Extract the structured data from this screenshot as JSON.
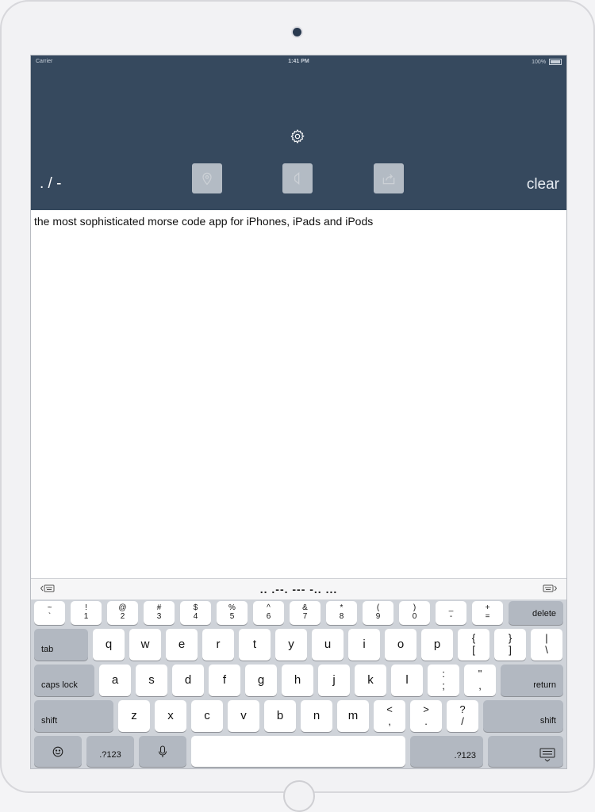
{
  "status": {
    "carrier": "Carrier",
    "time": "1:41 PM",
    "battery": "100%"
  },
  "header": {
    "morse_symbols": ". / -",
    "clear_label": "clear",
    "icons": [
      "gear-icon",
      "location-pin-icon",
      "speaker-icon",
      "share-icon"
    ]
  },
  "content": {
    "text": "the most sophisticated morse code app for iPhones, iPads and iPods"
  },
  "keyboard": {
    "morse_preview": ".. .--. --- -.. ...",
    "number_row": [
      {
        "top": "~",
        "bottom": "`"
      },
      {
        "top": "!",
        "bottom": "1"
      },
      {
        "top": "@",
        "bottom": "2"
      },
      {
        "top": "#",
        "bottom": "3"
      },
      {
        "top": "$",
        "bottom": "4"
      },
      {
        "top": "%",
        "bottom": "5"
      },
      {
        "top": "^",
        "bottom": "6"
      },
      {
        "top": "&",
        "bottom": "7"
      },
      {
        "top": "*",
        "bottom": "8"
      },
      {
        "top": "(",
        "bottom": "9"
      },
      {
        "top": ")",
        "bottom": "0"
      },
      {
        "top": "_",
        "bottom": "-"
      },
      {
        "top": "+",
        "bottom": "="
      }
    ],
    "delete_label": "delete",
    "tab_label": "tab",
    "row_q": [
      "q",
      "w",
      "e",
      "r",
      "t",
      "y",
      "u",
      "i",
      "o",
      "p"
    ],
    "row_q_extra": [
      {
        "top": "{",
        "bottom": "["
      },
      {
        "top": "}",
        "bottom": "]"
      },
      {
        "top": "|",
        "bottom": "\\"
      }
    ],
    "caps_label": "caps lock",
    "row_a": [
      "a",
      "s",
      "d",
      "f",
      "g",
      "h",
      "j",
      "k",
      "l"
    ],
    "row_a_extra": [
      {
        "top": ":",
        "bottom": ";"
      },
      {
        "top": "\"",
        "bottom": ","
      }
    ],
    "return_label": "return",
    "shift_label": "shift",
    "row_z": [
      "z",
      "x",
      "c",
      "v",
      "b",
      "n",
      "m"
    ],
    "row_z_extra": [
      {
        "top": "<",
        "bottom": ","
      },
      {
        "top": ">",
        "bottom": "."
      },
      {
        "top": "?",
        "bottom": "/"
      }
    ],
    "numbers_label": ".?123",
    "bottom_icons": [
      "emoji-icon",
      "microphone-icon",
      "keyboard-dismiss-icon"
    ]
  }
}
